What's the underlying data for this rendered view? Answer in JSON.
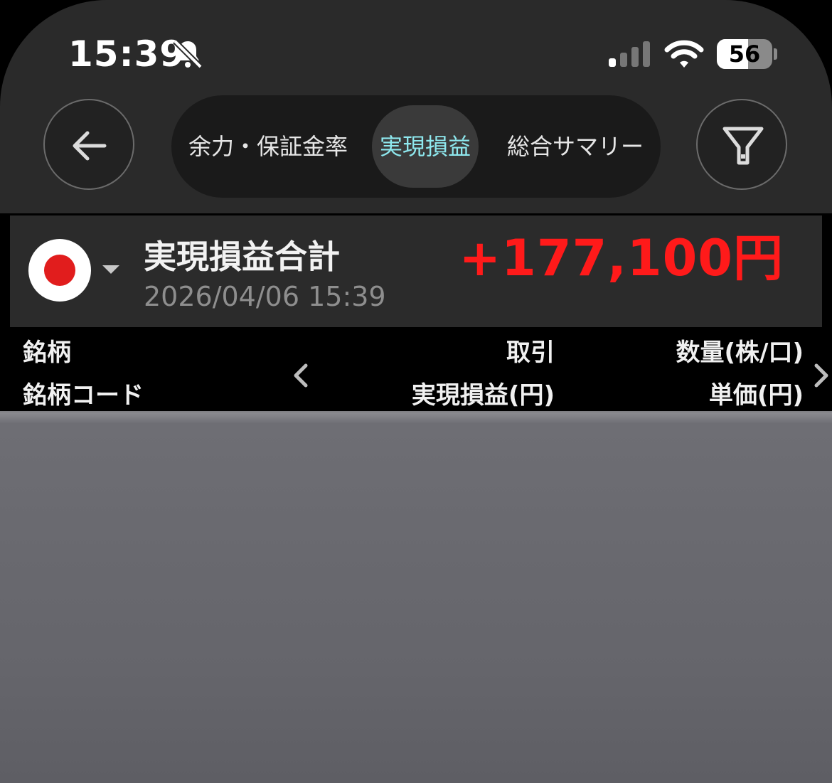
{
  "status_bar": {
    "time": "15:39",
    "battery": "56",
    "battery_level_percent": 56,
    "icons": [
      "bell-muted-icon",
      "signal-icon",
      "wifi-icon",
      "battery-icon"
    ]
  },
  "nav": {
    "back_icon": "arrow-left-icon",
    "filter_icon": "filter-icon",
    "tabs": [
      {
        "label": "余力・保証金率",
        "active": false
      },
      {
        "label": "実現損益",
        "active": true
      },
      {
        "label": "総合サマリー",
        "active": false
      }
    ],
    "active_tab_color": "#8ee8ee"
  },
  "summary": {
    "flag_icon": "japan-flag-icon",
    "title": "実現損益合計",
    "date": "2026/04/06 15:39",
    "amount": "+177,100円",
    "amount_color": "#ff1a1a"
  },
  "table_header": {
    "name": "銘柄",
    "code": "銘柄コード",
    "trade": "取引",
    "pnl": "実現損益(円)",
    "qty": "数量(株/口)",
    "price": "単価(円)",
    "left_icon": "chevron-left-icon",
    "right_icon": "chevron-right-icon"
  }
}
